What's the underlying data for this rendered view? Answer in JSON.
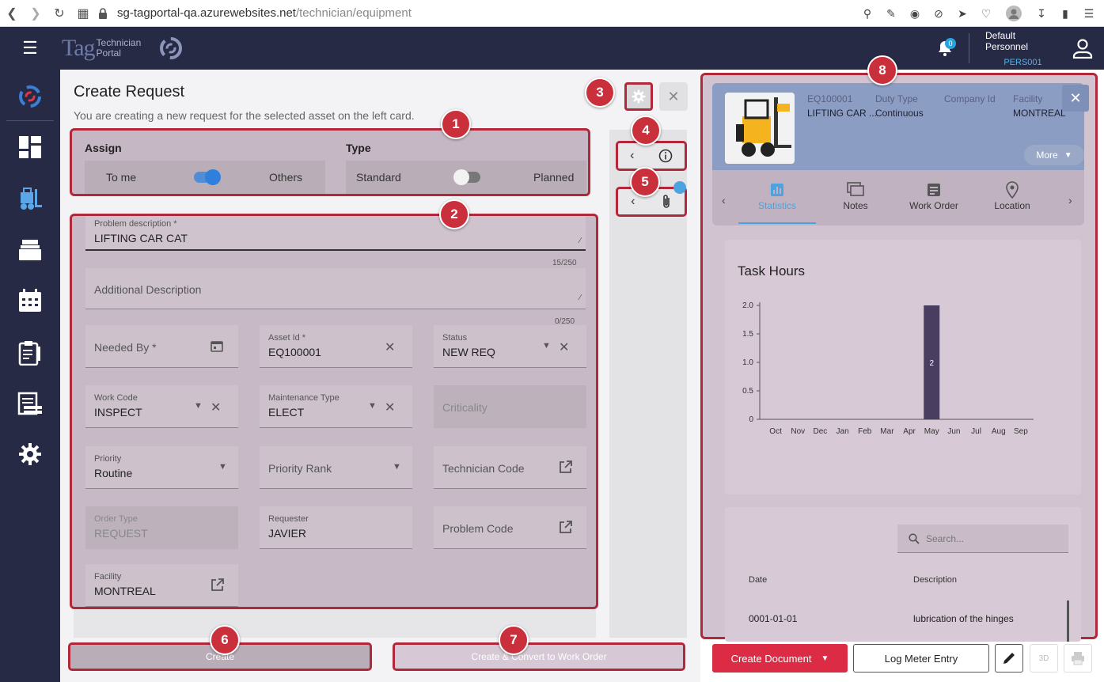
{
  "browser": {
    "url_host": "sg-tagportal-qa.azurewebsites.net",
    "url_path": "/technician/equipment"
  },
  "header": {
    "logo_tag": "Tag",
    "logo_line1": "Technician",
    "logo_line2": "Portal",
    "notification_count": "0",
    "user_name": "Default Personnel",
    "user_id": "PERS001"
  },
  "sidebar": {
    "items": [
      "logo-swirl-icon",
      "dashboard-icon",
      "forklift-icon",
      "folders-icon",
      "calendar-icon",
      "clipboard-icon",
      "report-list-icon",
      "gear-icon"
    ]
  },
  "request": {
    "title": "Create Request",
    "subtitle": "You are creating a new request for the selected asset on the left card.",
    "assign_label": "Assign",
    "assign_left": "To me",
    "assign_right": "Others",
    "type_label": "Type",
    "type_left": "Standard",
    "type_right": "Planned"
  },
  "form": {
    "problem_label": "Problem description *",
    "problem_value": "LIFTING CAR CAT",
    "problem_counter": "15/250",
    "additional_placeholder": "Additional Description",
    "additional_counter": "0/250",
    "needed_by_placeholder": "Needed By *",
    "asset_label": "Asset Id *",
    "asset_value": "EQ100001",
    "status_label": "Status",
    "status_value": "NEW REQ",
    "work_code_label": "Work Code",
    "work_code_value": "INSPECT",
    "maint_type_label": "Maintenance Type",
    "maint_type_value": "ELECT",
    "criticality_placeholder": "Criticality",
    "priority_label": "Priority",
    "priority_value": "Routine",
    "priority_rank_placeholder": "Priority Rank",
    "technician_code_placeholder": "Technician Code",
    "order_type_label": "Order Type",
    "order_type_value": "REQUEST",
    "requester_label": "Requester",
    "requester_value": "JAVIER",
    "problem_code_placeholder": "Problem Code",
    "facility_label": "Facility",
    "facility_value": "MONTREAL"
  },
  "buttons": {
    "create": "Create",
    "convert": "Create & Convert to Work Order",
    "create_document": "Create Document",
    "log_meter": "Log Meter Entry",
    "three_d": "3D",
    "more": "More"
  },
  "callouts": [
    "1",
    "2",
    "3",
    "4",
    "5",
    "6",
    "7",
    "8"
  ],
  "asset_card": {
    "asset_id": "EQ100001",
    "asset_name": "LIFTING CAR ...",
    "duty_type_label": "Duty Type",
    "duty_type_value": "Continuous",
    "company_label": "Company Id",
    "company_value": "",
    "facility_label": "Facility",
    "facility_value": "MONTREAL"
  },
  "tabs": [
    {
      "label": "Statistics",
      "icon": "bar-chart-icon",
      "active": true
    },
    {
      "label": "Notes",
      "icon": "notes-icon",
      "active": false
    },
    {
      "label": "Work Order",
      "icon": "work-order-icon",
      "active": false
    },
    {
      "label": "Location",
      "icon": "location-pin-icon",
      "active": false
    }
  ],
  "chart_data": {
    "type": "bar",
    "title": "Task Hours",
    "categories": [
      "Oct",
      "Nov",
      "Dec",
      "Jan",
      "Feb",
      "Mar",
      "Apr",
      "May",
      "Jun",
      "Jul",
      "Aug",
      "Sep"
    ],
    "values": [
      0,
      0,
      0,
      0,
      0,
      0,
      0,
      2,
      0,
      0,
      0,
      0
    ],
    "ylim": [
      0,
      2
    ],
    "yticks": [
      "0",
      "0.5",
      "1.0",
      "1.5",
      "2.0"
    ],
    "data_labels": {
      "May": "2"
    },
    "bar_color": "#4a3e60",
    "grid": false
  },
  "history": {
    "search_placeholder": "Search...",
    "col_date": "Date",
    "col_description": "Description",
    "rows": [
      {
        "date": "0001-01-01",
        "description": "lubrication of the hinges"
      }
    ]
  },
  "colors": {
    "header_bg": "#262a45",
    "annotation_red": "#b0283a",
    "accent_blue": "#4ba3e0",
    "create_doc_red": "#dc2b45"
  }
}
